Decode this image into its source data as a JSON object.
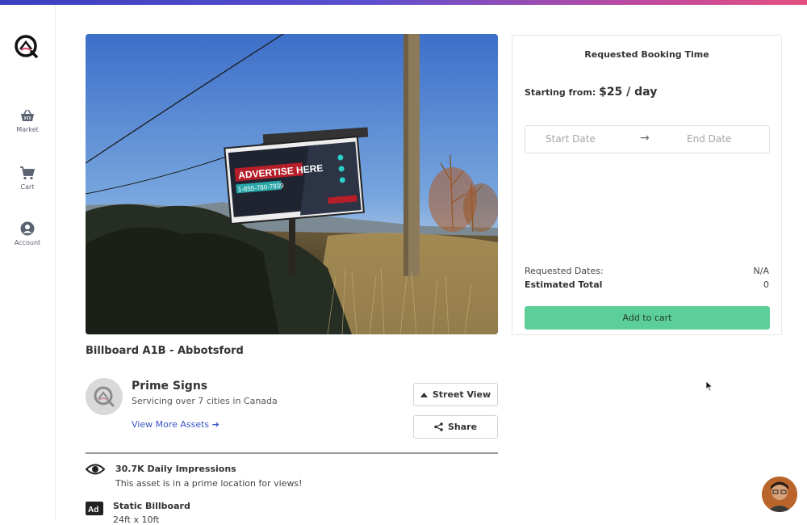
{
  "nav": {
    "items": [
      {
        "label": "Market",
        "icon": "basket-icon"
      },
      {
        "label": "Cart",
        "icon": "cart-icon"
      },
      {
        "label": "Account",
        "icon": "account-icon"
      }
    ]
  },
  "billboard": {
    "headline": "ADVERTISE HERE",
    "phone": "1-855-780-7839"
  },
  "asset": {
    "title": "Billboard A1B - Abbotsford"
  },
  "owner": {
    "name": "Prime Signs",
    "subtitle": "Servicing over 7 cities in Canada",
    "link_label": "View More Assets",
    "link_arrow": "➔"
  },
  "actions": {
    "street_view_label": "Street View",
    "share_label": "Share"
  },
  "features": [
    {
      "title": "30.7K Daily Impressions",
      "subtitle": "This asset is in a prime location for views!"
    },
    {
      "title": "Static Billboard",
      "subtitle": "24ft x 10ft"
    }
  ],
  "booking": {
    "title": "Requested Booking Time",
    "price_prefix": "Starting from:",
    "price": "$25 / day",
    "start_placeholder": "Start Date",
    "arrow": "→",
    "end_placeholder": "End Date",
    "requested_label": "Requested Dates:",
    "requested_value": "N/A",
    "total_label": "Estimated Total",
    "total_value": "0",
    "add_label": "Add to cart"
  },
  "colors": {
    "accent_green": "#5ccf98",
    "link_blue": "#3a55c4",
    "brand_gradient_start": "#3a3fc0",
    "brand_gradient_end": "#e2507f"
  }
}
